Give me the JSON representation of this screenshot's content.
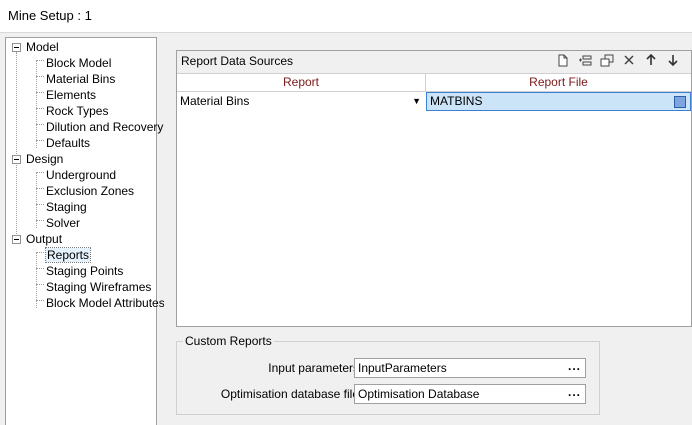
{
  "window": {
    "title": "Mine Setup : 1"
  },
  "tree": {
    "nodes": [
      {
        "label": "Model",
        "kind": "category"
      },
      {
        "label": "Block Model",
        "kind": "leaf"
      },
      {
        "label": "Material Bins",
        "kind": "leaf"
      },
      {
        "label": "Elements",
        "kind": "leaf"
      },
      {
        "label": "Rock Types",
        "kind": "leaf"
      },
      {
        "label": "Dilution and Recovery",
        "kind": "leaf"
      },
      {
        "label": "Defaults",
        "kind": "leaf"
      },
      {
        "label": "Design",
        "kind": "category"
      },
      {
        "label": "Underground",
        "kind": "leaf"
      },
      {
        "label": "Exclusion Zones",
        "kind": "leaf"
      },
      {
        "label": "Staging",
        "kind": "leaf"
      },
      {
        "label": "Solver",
        "kind": "leaf"
      },
      {
        "label": "Output",
        "kind": "category"
      },
      {
        "label": "Reports",
        "kind": "leaf",
        "selected": true
      },
      {
        "label": "Staging Points",
        "kind": "leaf"
      },
      {
        "label": "Staging Wireframes",
        "kind": "leaf"
      },
      {
        "label": "Block Model Attributes",
        "kind": "leaf"
      }
    ]
  },
  "report_sources": {
    "title": "Report Data Sources",
    "toolbar": [
      "new-icon",
      "insert-icon",
      "duplicate-icon",
      "delete-icon",
      "move-up-icon",
      "move-down-icon"
    ],
    "columns": [
      "Report",
      "Report File"
    ],
    "rows": [
      {
        "report": "Material Bins",
        "file": "MATBINS"
      }
    ]
  },
  "custom_reports": {
    "legend": "Custom Reports",
    "input_parameters": {
      "label": "Input parameters",
      "value": "InputParameters",
      "button": "..."
    },
    "optimisation_db": {
      "label": "Optimisation database file",
      "value": "Optimisation Database",
      "button": "..."
    }
  },
  "colors": {
    "selection": "#cce4f7",
    "header_text": "#7a1a1a"
  }
}
